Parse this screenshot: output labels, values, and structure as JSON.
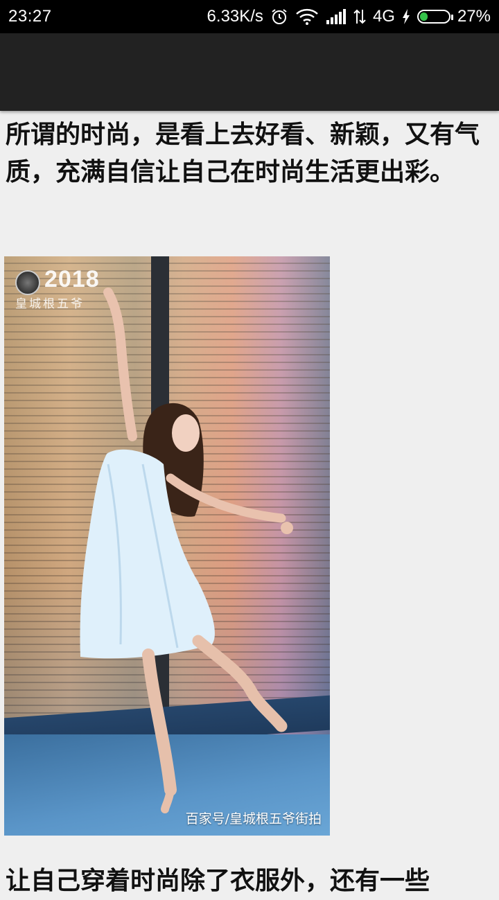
{
  "status_bar": {
    "time": "23:27",
    "network_speed": "6.33K/s",
    "network_type": "4G",
    "battery_percent": "27%",
    "battery_level": 0.27,
    "icons": [
      "alarm-icon",
      "wifi-icon",
      "signal-icon",
      "data-transfer-icon",
      "charging-icon",
      "battery-icon"
    ]
  },
  "article": {
    "paragraph_1": "所谓的时尚，是看上去好看、新颖，又有气质，充满自信让自己在时尚生活更出彩。",
    "paragraph_2": "让自己穿着时尚除了衣服外，还有一些",
    "image": {
      "watermark_year": "2018",
      "watermark_name": "皇城根五爷",
      "caption": "百家号/皇城根五爷街拍"
    }
  },
  "colors": {
    "status_bar_bg": "#000000",
    "app_bar_bg": "#222222",
    "page_bg": "#efefef",
    "battery_fill": "#35c24a"
  }
}
